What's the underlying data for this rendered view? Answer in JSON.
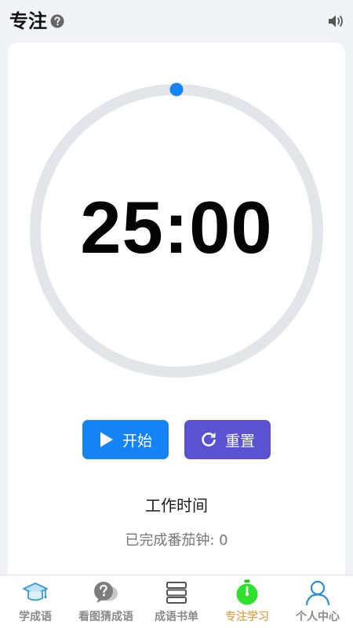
{
  "header": {
    "title": "专注",
    "help_icon": "question-circle-icon",
    "sound_icon": "speaker-icon"
  },
  "timer": {
    "time": "25:00",
    "progress": 0,
    "colors": {
      "track": "#e4e5ea",
      "indicator": "#1584f6"
    }
  },
  "controls": {
    "start_label": "开始",
    "reset_label": "重置",
    "start_icon": "play-icon",
    "reset_icon": "refresh-icon",
    "start_color": "#1483f5",
    "reset_color": "#5b52d3"
  },
  "status": {
    "mode": "工作时间",
    "completed": "已完成番茄钟: 0"
  },
  "tabbar": {
    "items": [
      {
        "label": "学成语",
        "icon": "graduation-cap-icon",
        "active": false
      },
      {
        "label": "看图猜成语",
        "icon": "question-bubble-icon",
        "active": false
      },
      {
        "label": "成语书单",
        "icon": "book-stack-icon",
        "active": false
      },
      {
        "label": "专注学习",
        "icon": "stopwatch-icon",
        "active": true
      },
      {
        "label": "个人中心",
        "icon": "user-icon",
        "active": false
      }
    ],
    "active_color": "#d9b165"
  }
}
